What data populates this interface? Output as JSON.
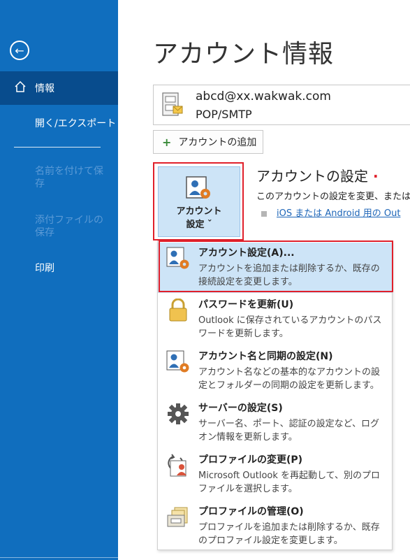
{
  "sidebar": {
    "back_icon": "back-arrow-icon",
    "items": [
      {
        "label": "情報",
        "icon": "home-icon",
        "active": true
      },
      {
        "label": "開く/エクスポート"
      },
      {
        "label": "名前を付けて保存",
        "disabled": true
      },
      {
        "label": "添付ファイルの保存",
        "disabled": true
      },
      {
        "label": "印刷"
      }
    ]
  },
  "main": {
    "title": "アカウント情報",
    "account": {
      "email": "abcd@xx.wakwak.com",
      "type": "POP/SMTP"
    },
    "add_account_label": "アカウントの追加",
    "account_settings_button": {
      "line1": "アカウント",
      "line2": "設定 ˇ"
    },
    "settings_title": "アカウントの設定",
    "settings_desc": "このアカウントの設定を変更、または追",
    "settings_link": "iOS または Android 用の Out"
  },
  "menu": {
    "items": [
      {
        "title": "アカウント設定(A)...",
        "desc": "アカウントを追加または削除するか、既存の接続設定を変更します。",
        "icon": "account-settings-icon",
        "highlight": true
      },
      {
        "title": "パスワードを更新(U)",
        "desc": "Outlook に保存されているアカウントのパスワードを更新します。",
        "icon": "lock-icon"
      },
      {
        "title": "アカウント名と同期の設定(N)",
        "desc": "アカウント名などの基本的なアカウントの設定とフォルダーの同期の設定を更新します。",
        "icon": "account-sync-icon"
      },
      {
        "title": "サーバーの設定(S)",
        "desc": "サーバー名、ポート、認証の設定など、ログオン情報を更新します。",
        "icon": "gear-icon"
      },
      {
        "title": "プロファイルの変更(P)",
        "desc": "Microsoft Outlook を再起動して、別のプロファイルを選択します。",
        "icon": "profile-change-icon"
      },
      {
        "title": "プロファイルの管理(O)",
        "desc": "プロファイルを追加または削除するか、既存のプロファイル設定を変更します。",
        "icon": "profile-manage-icon"
      }
    ]
  },
  "colors": {
    "sidebar": "#106ebe",
    "sidebar_active": "#084c8d",
    "highlight": "#cde4f7",
    "callout_red": "#e0202b"
  }
}
